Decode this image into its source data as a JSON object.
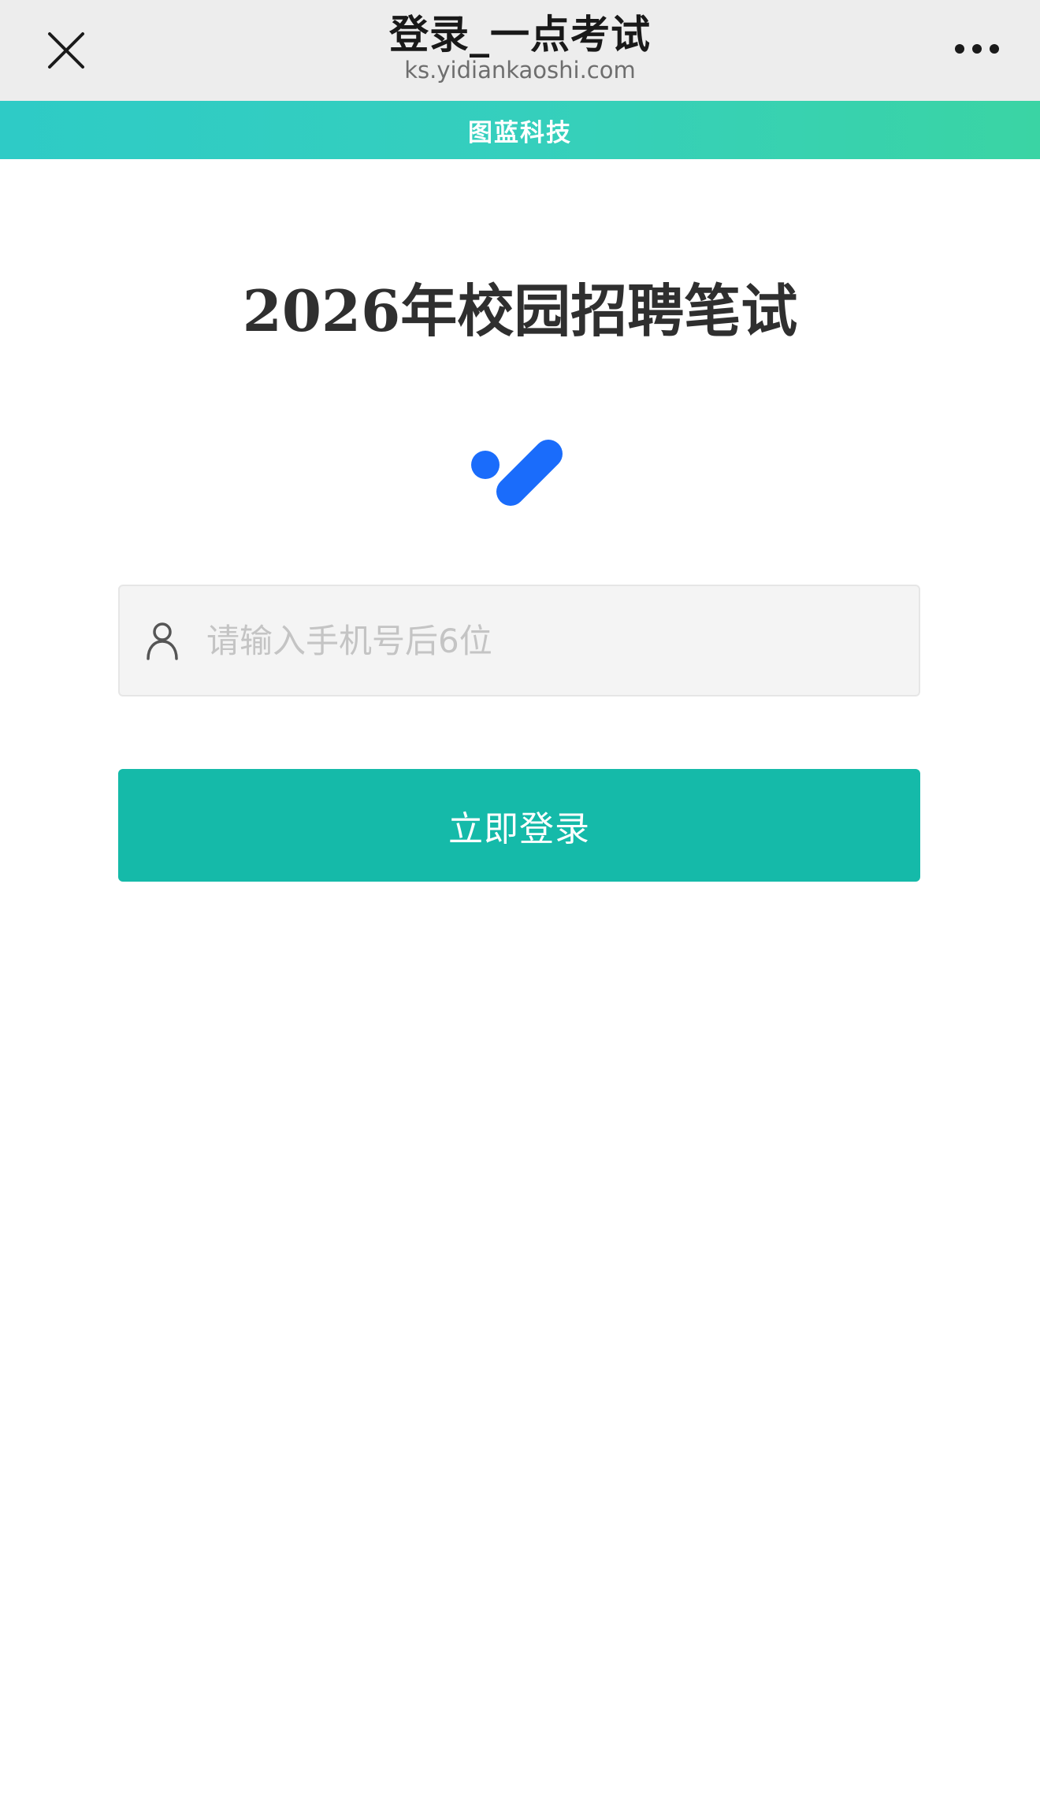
{
  "browser": {
    "title": "登录_一点考试",
    "url": "ks.yidiankaoshi.com",
    "close_icon": "close-icon",
    "more_icon": "more-icon"
  },
  "banner": {
    "text": "图蓝科技",
    "colors": [
      "#2ecbc6",
      "#3ad4a4"
    ]
  },
  "main": {
    "title": "2026年校园招聘笔试",
    "logo_icon": "logo-icon",
    "logo_color": "#1a6cfb",
    "phone_field": {
      "value": "",
      "placeholder": "请输入手机号后6位",
      "icon": "user-icon"
    },
    "login_button_label": "立即登录",
    "accent_color": "#15baa9"
  }
}
